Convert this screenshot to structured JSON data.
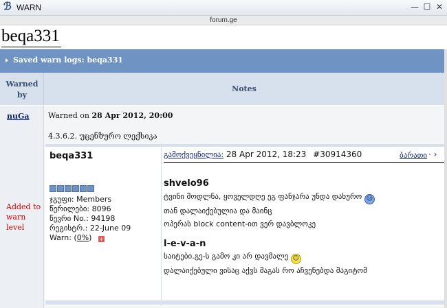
{
  "window": {
    "title": "WARN",
    "minimize": "—",
    "restore": "☐",
    "close": "✕",
    "url": "forum.ge"
  },
  "page": {
    "heading": "beqa331",
    "section_title": "Saved warn logs: beqa331"
  },
  "columns": {
    "warned_by": "Warned by",
    "notes": "Notes"
  },
  "log": {
    "warned_by_user": "nuGa",
    "warned_on_label": "Warned on",
    "warned_on_date": "28 Apr 2012, 20:00",
    "reason": "4.3.6.2. უცენზურო ლექსიკა",
    "status": "Added to warn level"
  },
  "post": {
    "author": "beqa331",
    "group": "ჯგუფი: Members",
    "posts": "წერილები: 8096",
    "number": "წევრი No.: 94198",
    "registered": "რეგისტრ.: 22-June 09",
    "warn_label": "Warn: (",
    "warn_value": "0%",
    "warn_close": ")",
    "published_label": "გამოქვეყნილია:",
    "published_date": "28 Apr 2012, 18:23",
    "post_id": "#30914360",
    "report": "ბარათი",
    "quotes": [
      {
        "name": "shvelo96",
        "lines": [
          "ტვინი მოდლნა, ყოველდღე ეგ ფანჯარა უნდა დახურო",
          "თან დალაიქებულია და მაინც",
          "ოპერას block content-ით ვერ დავბლოკე"
        ],
        "emoticon": "sad-face-icon"
      },
      {
        "name": "l-e-v-a-n",
        "lines": [
          "საიტები.გე-ს გამო კი არ დავმალე",
          "დალაიქებული ვისაც აქვს მაგას რო აჩვენებდა მაგიტომ"
        ],
        "emoticon": "smile-icon"
      }
    ]
  },
  "colors": {
    "accent": "#6f94c3",
    "header_bg": "#d7e1ee",
    "status_red": "#cc0000"
  }
}
